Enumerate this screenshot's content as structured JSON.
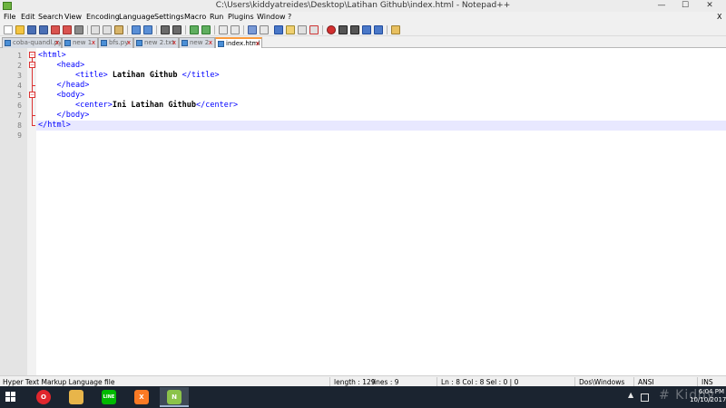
{
  "window": {
    "title": "C:\\Users\\kiddyatreides\\Desktop\\Latihan Github\\index.html - Notepad++",
    "min_label": "—",
    "max_label": "☐",
    "close_label": "✕"
  },
  "menu": {
    "items": [
      "File",
      "Edit",
      "Search",
      "View",
      "Encoding",
      "Language",
      "Settings",
      "Macro",
      "Run",
      "Plugins",
      "Window",
      "?"
    ],
    "close_label": "X"
  },
  "tabs": [
    {
      "label": "coba-quandl.py",
      "active": false
    },
    {
      "label": "new 1",
      "active": false
    },
    {
      "label": "bfs.py",
      "active": false
    },
    {
      "label": "new 2.txt",
      "active": false
    },
    {
      "label": "new 2",
      "active": false
    },
    {
      "label": "index.html",
      "active": true
    }
  ],
  "editor": {
    "line_numbers": [
      "1",
      "2",
      "3",
      "4",
      "5",
      "6",
      "7",
      "8",
      "9"
    ],
    "lines": [
      {
        "indent": "",
        "open": "<html>",
        "text": "",
        "close": ""
      },
      {
        "indent": "    ",
        "open": "<head>",
        "text": "",
        "close": ""
      },
      {
        "indent": "        ",
        "open": "<title>",
        "text": " Latihan Github ",
        "close": "</title>"
      },
      {
        "indent": "    ",
        "open": "</head>",
        "text": "",
        "close": ""
      },
      {
        "indent": "    ",
        "open": "<body>",
        "text": "",
        "close": ""
      },
      {
        "indent": "        ",
        "open": "<center>",
        "text": "Ini Latihan Github",
        "close": "</center>"
      },
      {
        "indent": "    ",
        "open": "</body>",
        "text": "",
        "close": ""
      },
      {
        "indent": "",
        "open": "</html>",
        "text": "",
        "close": ""
      },
      {
        "indent": "",
        "open": "",
        "text": "",
        "close": ""
      }
    ],
    "fold_markers": [
      "−",
      "−",
      "−"
    ]
  },
  "statusbar": {
    "file_type": "Hyper Text Markup Language file",
    "length": "length : 129",
    "lines": "lines : 9",
    "position": "Ln : 8    Col : 8    Sel : 0 | 0",
    "eol": "Dos\\Windows",
    "encoding": "ANSI",
    "mode": "INS"
  },
  "taskbar": {
    "apps": [
      {
        "name": "opera",
        "glyph": "O",
        "color": "#e0262d"
      },
      {
        "name": "file-explorer",
        "glyph": "",
        "color": "#e8b54a"
      },
      {
        "name": "line",
        "glyph": "LINE",
        "color": "#00b900"
      },
      {
        "name": "xampp",
        "glyph": "X",
        "color": "#fb7a24"
      },
      {
        "name": "notepad-plus-plus",
        "glyph": "N",
        "color": "#8bc34a"
      }
    ],
    "clock_time": "6:04 PM",
    "clock_date": "10/10/2017",
    "tray_arrow": "▲",
    "watermark": "# Kiddy"
  }
}
